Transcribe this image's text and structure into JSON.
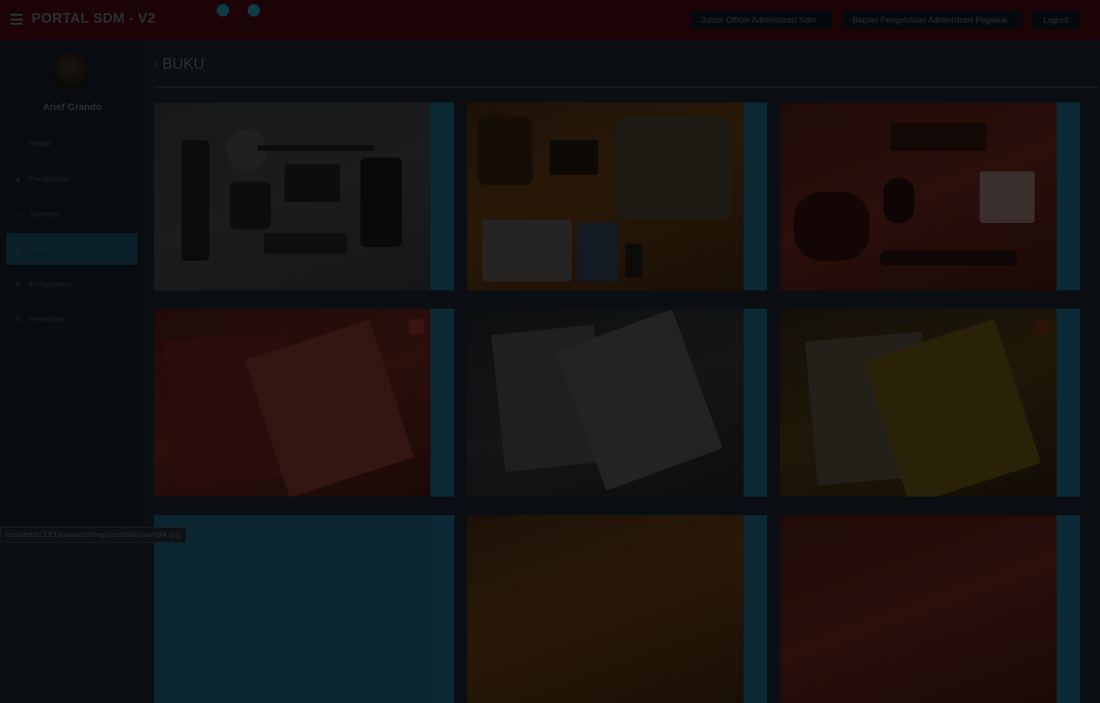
{
  "app": {
    "brand": "PORTAL SDM - V2"
  },
  "header": {
    "role_label": "Junior Officer Administrasi Sdm",
    "dept_label": "Bagian Pengelolaan Administrasi Pegawai",
    "logout_label": "Logout"
  },
  "sidebar": {
    "user_name": "Arief Grando",
    "items": [
      {
        "label": "Home",
        "icon": "home-icon"
      },
      {
        "label": "Pendidikan",
        "icon": "graduation-cap-icon"
      },
      {
        "label": "Seminar",
        "icon": "monitor-icon"
      },
      {
        "label": "Buku",
        "icon": "book-icon",
        "active": true
      },
      {
        "label": "Kompetensi",
        "icon": "cogs-icon"
      },
      {
        "label": "Penelitian",
        "icon": "list-icon"
      }
    ]
  },
  "page": {
    "title": "BUKU"
  },
  "gallery": [
    {
      "name": "gallery-item-gear-flatlay",
      "tone": "paper"
    },
    {
      "name": "gallery-item-shoes-flatlay",
      "tone": "wood"
    },
    {
      "name": "gallery-item-travel-flatlay",
      "tone": "red"
    },
    {
      "name": "gallery-item-book-cover-1",
      "tone": "red"
    },
    {
      "name": "gallery-item-book-cover-2",
      "tone": "dark"
    },
    {
      "name": "gallery-item-book-cover-3",
      "tone": "yellow"
    }
  ],
  "status_bar": {
    "url": "localhost:3333/assets/img/portfolio/port04.jpg"
  }
}
